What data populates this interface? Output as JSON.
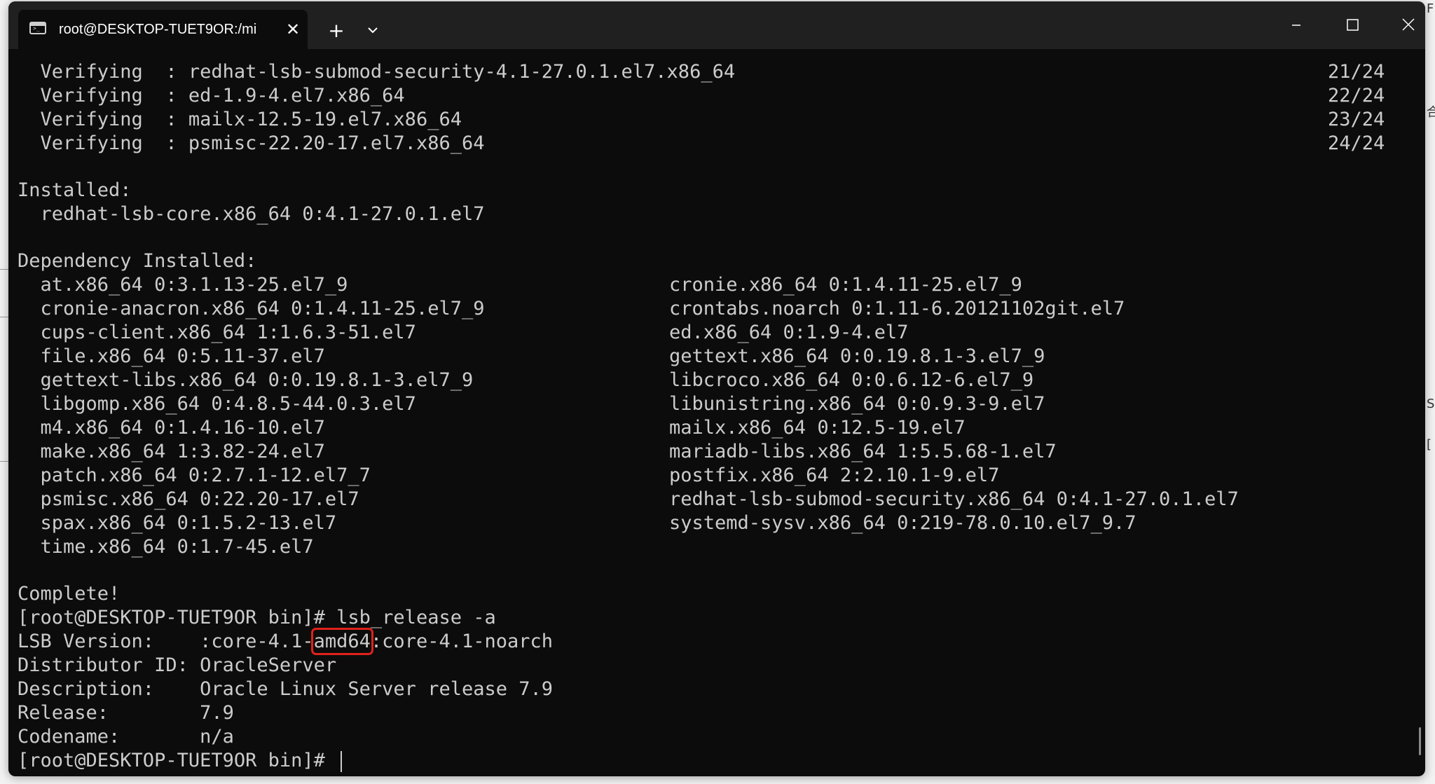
{
  "desktop": {
    "edge_glyphs": [
      "F",
      "合",
      "S",
      "["
    ]
  },
  "window": {
    "tab": {
      "title": "root@DESKTOP-TUET9OR:/mi",
      "close_glyph": "✕"
    },
    "new_tab_glyph": "+",
    "controls": [
      "minimize",
      "maximize",
      "close"
    ]
  },
  "terminal": {
    "verifying": [
      {
        "label": "  Verifying  : redhat-lsb-submod-security-4.1-27.0.1.el7.x86_64",
        "progress": "21/24"
      },
      {
        "label": "  Verifying  : ed-1.9-4.el7.x86_64",
        "progress": "22/24"
      },
      {
        "label": "  Verifying  : mailx-12.5-19.el7.x86_64",
        "progress": "23/24"
      },
      {
        "label": "  Verifying  : psmisc-22.20-17.el7.x86_64",
        "progress": "24/24"
      }
    ],
    "installed_header": "Installed:",
    "installed_items": [
      "  redhat-lsb-core.x86_64 0:4.1-27.0.1.el7"
    ],
    "dependency_header": "Dependency Installed:",
    "dependencies": [
      {
        "left": "  at.x86_64 0:3.1.13-25.el7_9",
        "right": "cronie.x86_64 0:1.4.11-25.el7_9"
      },
      {
        "left": "  cronie-anacron.x86_64 0:1.4.11-25.el7_9",
        "right": "crontabs.noarch 0:1.11-6.20121102git.el7"
      },
      {
        "left": "  cups-client.x86_64 1:1.6.3-51.el7",
        "right": "ed.x86_64 0:1.9-4.el7"
      },
      {
        "left": "  file.x86_64 0:5.11-37.el7",
        "right": "gettext.x86_64 0:0.19.8.1-3.el7_9"
      },
      {
        "left": "  gettext-libs.x86_64 0:0.19.8.1-3.el7_9",
        "right": "libcroco.x86_64 0:0.6.12-6.el7_9"
      },
      {
        "left": "  libgomp.x86_64 0:4.8.5-44.0.3.el7",
        "right": "libunistring.x86_64 0:0.9.3-9.el7"
      },
      {
        "left": "  m4.x86_64 0:1.4.16-10.el7",
        "right": "mailx.x86_64 0:12.5-19.el7"
      },
      {
        "left": "  make.x86_64 1:3.82-24.el7",
        "right": "mariadb-libs.x86_64 1:5.5.68-1.el7"
      },
      {
        "left": "  patch.x86_64 0:2.7.1-12.el7_7",
        "right": "postfix.x86_64 2:2.10.1-9.el7"
      },
      {
        "left": "  psmisc.x86_64 0:22.20-17.el7",
        "right": "redhat-lsb-submod-security.x86_64 0:4.1-27.0.1.el7"
      },
      {
        "left": "  spax.x86_64 0:1.5.2-13.el7",
        "right": "systemd-sysv.x86_64 0:219-78.0.10.el7_9.7"
      },
      {
        "left": "  time.x86_64 0:1.7-45.el7",
        "right": ""
      }
    ],
    "complete": "Complete!",
    "command_line": "[root@DESKTOP-TUET9OR bin]# lsb_release -a",
    "lsb_version": {
      "prefix": "LSB Version:    :core-4.1-",
      "highlight": "amd64",
      "suffix": ":core-4.1-noarch"
    },
    "distributor": "Distributor ID: OracleServer",
    "description": "Description:    Oracle Linux Server release 7.9",
    "release": "Release:        7.9",
    "codename": "Codename:       n/a",
    "prompt": "[root@DESKTOP-TUET9OR bin]# "
  },
  "colors": {
    "terminal_bg": "#0c0c0c",
    "terminal_fg": "#cccccc",
    "titlebar_bg": "#202020",
    "highlight_box": "#e0221a"
  }
}
